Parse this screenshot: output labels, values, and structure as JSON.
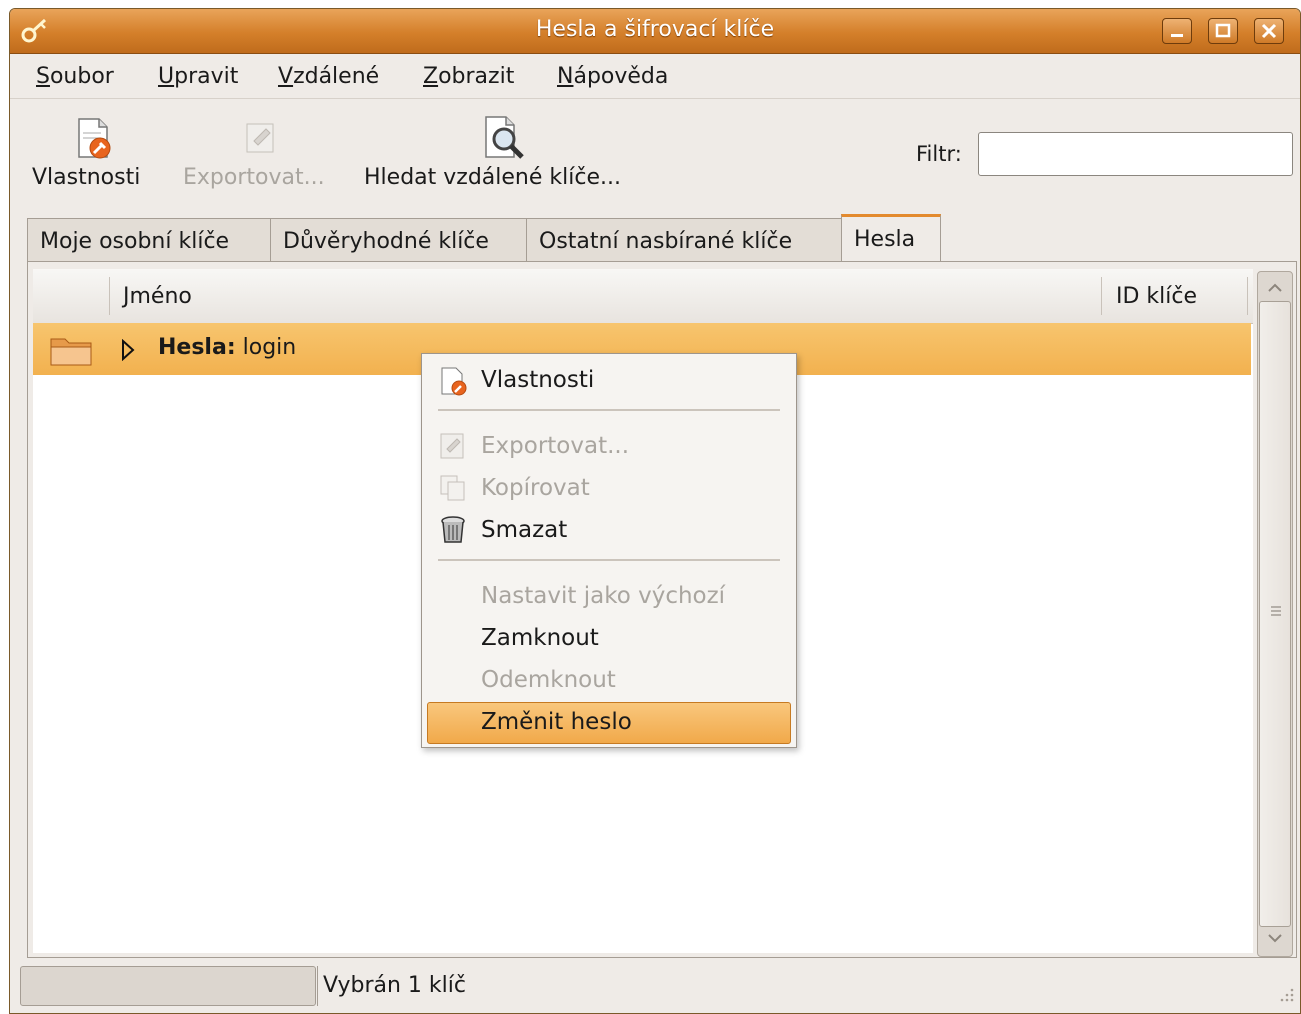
{
  "window": {
    "title": "Hesla a šifrovací klíče"
  },
  "menubar": {
    "items": [
      {
        "label": "Soubor",
        "mnemonic": "S"
      },
      {
        "label": "Upravit",
        "mnemonic": "U"
      },
      {
        "label": "Vzdálené",
        "mnemonic": "V"
      },
      {
        "label": "Zobrazit",
        "mnemonic": "Z"
      },
      {
        "label": "Nápověda",
        "mnemonic": "N"
      }
    ]
  },
  "toolbar": {
    "properties_label": "Vlastnosti",
    "export_label": "Exportovat...",
    "search_remote_label": "Hledat vzdálené klíče...",
    "filter_label": "Filtr:",
    "filter_value": ""
  },
  "tabs": [
    {
      "label": "Moje osobní klíče",
      "active": false
    },
    {
      "label": "Důvěryhodné klíče",
      "active": false
    },
    {
      "label": "Ostatní nasbírané klíče",
      "active": false
    },
    {
      "label": "Hesla",
      "active": true
    }
  ],
  "tree": {
    "columns": [
      "Jméno",
      "ID klíče"
    ],
    "rows": [
      {
        "bold": "Hesla:",
        "rest": "login",
        "selected": true
      }
    ]
  },
  "context_menu": {
    "items": [
      {
        "label": "Vlastnosti",
        "enabled": true,
        "icon": "properties-icon"
      },
      {
        "label": "Exportovat...",
        "enabled": false,
        "icon": "export-icon"
      },
      {
        "label": "Kopírovat",
        "enabled": false,
        "icon": "copy-icon"
      },
      {
        "label": "Smazat",
        "enabled": true,
        "icon": "trash-icon"
      },
      {
        "label": "Nastavit jako výchozí",
        "enabled": false
      },
      {
        "label": "Zamknout",
        "enabled": true
      },
      {
        "label": "Odemknout",
        "enabled": false
      },
      {
        "label": "Změnit heslo",
        "enabled": true,
        "highlighted": true
      }
    ]
  },
  "statusbar": {
    "text": "Vybrán 1 klíč"
  },
  "colors": {
    "accent": "#e38a2e",
    "selection": "#f2b14f",
    "titlebar": "#d47f2a"
  }
}
